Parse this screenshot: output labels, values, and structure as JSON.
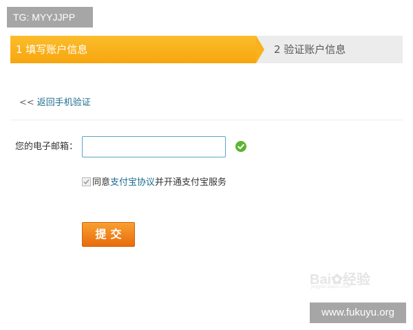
{
  "watermark_tag": "TG: MYYJJPP",
  "steps": [
    {
      "label": "1 填写账户信息",
      "active": true
    },
    {
      "label": "2 验证账户信息",
      "active": false
    }
  ],
  "back_link": {
    "icon": "<<",
    "label": "返回手机验证"
  },
  "form": {
    "email_label": "您的电子邮箱：",
    "email_value": "",
    "email_valid_icon": "check-circle-icon"
  },
  "agreement": {
    "checked": true,
    "prefix": "同意",
    "link": "支付宝协议",
    "suffix": "并开通支付宝服务"
  },
  "submit_label": "提交",
  "baidu_watermark": {
    "text": "Bai",
    "text2": "经验",
    "sub": "jingyan.baidu.com"
  },
  "site_watermark": "www.fukuyu.org",
  "colors": {
    "step_active": "#f9b11d",
    "step_inactive": "#ececec",
    "link": "#1b6b8f",
    "submit": "#ef8320",
    "valid": "#5cb531"
  }
}
